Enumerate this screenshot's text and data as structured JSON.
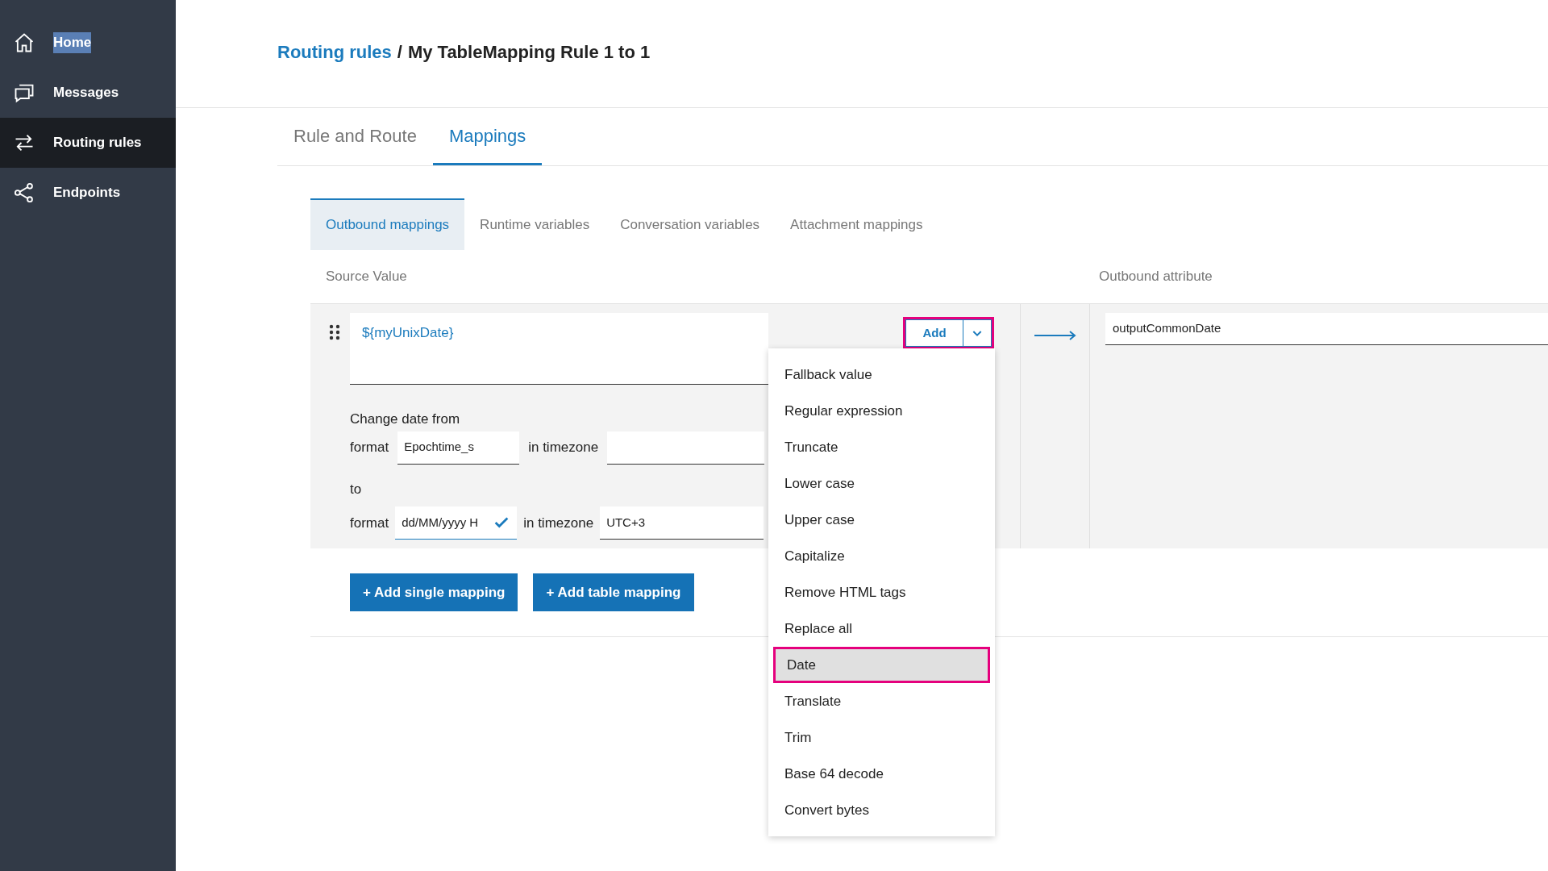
{
  "sidebar": {
    "items": [
      {
        "label": "Home",
        "selected": false,
        "text_highlighted": true
      },
      {
        "label": "Messages",
        "selected": false,
        "text_highlighted": false
      },
      {
        "label": "Routing rules",
        "selected": true,
        "text_highlighted": false
      },
      {
        "label": "Endpoints",
        "selected": false,
        "text_highlighted": false
      }
    ]
  },
  "breadcrumb": {
    "link": "Routing rules",
    "separator": "/",
    "current": "My TableMapping Rule 1 to 1"
  },
  "tabs": [
    {
      "label": "Rule and Route",
      "selected": false
    },
    {
      "label": "Mappings",
      "selected": true
    }
  ],
  "subtabs": [
    {
      "label": "Outbound mappings",
      "selected": true
    },
    {
      "label": "Runtime variables",
      "selected": false
    },
    {
      "label": "Conversation variables",
      "selected": false
    },
    {
      "label": "Attachment mappings",
      "selected": false
    }
  ],
  "columns": {
    "source": "Source Value",
    "outbound": "Outbound attribute"
  },
  "mapping": {
    "source_value": "${myUnixDate}",
    "add_button": {
      "label": "Add",
      "highlighted": true
    },
    "date_change": {
      "from_label": "Change date from",
      "from": {
        "format_label": "format",
        "format": "Epochtime_s",
        "timezone_label": "in timezone"
      },
      "to_label": "to",
      "to": {
        "format_label": "format",
        "format": "dd/MM/yyyy H",
        "timezone_label": "in timezone",
        "timezone": "UTC+3",
        "valid": true
      }
    },
    "outbound_attribute": "outputCommonDate"
  },
  "buttons": [
    "+ Add single mapping",
    "+ Add table mapping"
  ],
  "menu": {
    "items": [
      {
        "label": "Fallback value",
        "selected": false,
        "highlighted": false
      },
      {
        "label": "Regular expression",
        "selected": false,
        "highlighted": false
      },
      {
        "label": "Truncate",
        "selected": false,
        "highlighted": false
      },
      {
        "label": "Lower case",
        "selected": false,
        "highlighted": false
      },
      {
        "label": "Upper case",
        "selected": false,
        "highlighted": false
      },
      {
        "label": "Capitalize",
        "selected": false,
        "highlighted": false
      },
      {
        "label": "Remove HTML tags",
        "selected": false,
        "highlighted": false
      },
      {
        "label": "Replace all",
        "selected": false,
        "highlighted": false
      },
      {
        "label": "Date",
        "selected": true,
        "highlighted": true
      },
      {
        "label": "Translate",
        "selected": false,
        "highlighted": false
      },
      {
        "label": "Trim",
        "selected": false,
        "highlighted": false
      },
      {
        "label": "Base 64 decode",
        "selected": false,
        "highlighted": false
      },
      {
        "label": "Convert bytes",
        "selected": false,
        "highlighted": false
      }
    ]
  }
}
